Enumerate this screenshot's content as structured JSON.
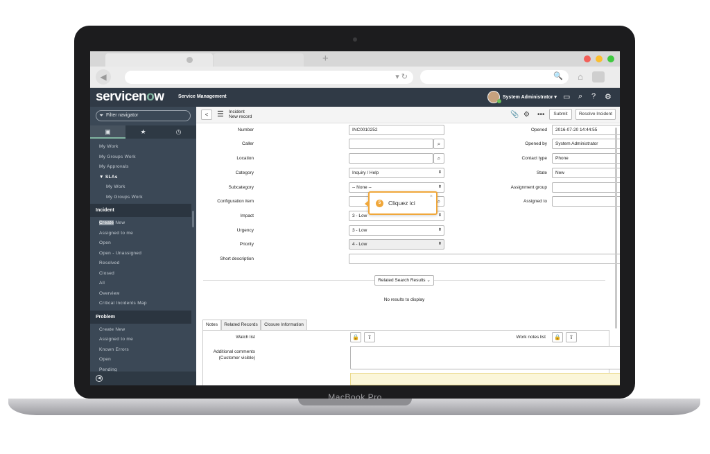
{
  "device": {
    "label": "MacBook Pro"
  },
  "browser": {
    "new_tab_symbol": "+"
  },
  "header": {
    "logo_prefix": "service",
    "logo_o": "o",
    "logo_suffix": "w",
    "logo_n": "n",
    "product": "Service Management",
    "user_name": "System Administrator ▾"
  },
  "sidebar": {
    "filter_placeholder": "Filter navigator",
    "items_top": [
      {
        "label": "My Work"
      },
      {
        "label": "My Groups Work"
      },
      {
        "label": "My Approvals"
      },
      {
        "label": "▼  SLAs"
      },
      {
        "label": "My Work"
      },
      {
        "label": "My Groups Work"
      }
    ],
    "section_incident": "Incident",
    "incident_items": [
      {
        "label_hl": "Create",
        "label": " New"
      },
      {
        "label": "Assigned to me"
      },
      {
        "label": "Open"
      },
      {
        "label": "Open - Unassigned"
      },
      {
        "label": "Resolved"
      },
      {
        "label": "Closed"
      },
      {
        "label": "All"
      },
      {
        "label": "Overview"
      },
      {
        "label": "Critical Incidents Map"
      }
    ],
    "section_problem": "Problem",
    "problem_items": [
      {
        "label": "Create New"
      },
      {
        "label": "Assigned to me"
      },
      {
        "label": "Known Errors"
      },
      {
        "label": "Open"
      },
      {
        "label": "Pending"
      }
    ]
  },
  "form": {
    "record_type": "Incident",
    "record_state": "New record",
    "submit_label": "Submit",
    "resolve_label": "Resolve Incident",
    "fields": {
      "number": {
        "label": "Number",
        "value": "INC0010252"
      },
      "caller": {
        "label": "Caller",
        "value": ""
      },
      "location": {
        "label": "Location",
        "value": ""
      },
      "category": {
        "label": "Category",
        "value": "Inquiry / Help"
      },
      "subcategory": {
        "label": "Subcategory",
        "value": "-- None --"
      },
      "config_item": {
        "label": "Configuration item",
        "value": ""
      },
      "impact": {
        "label": "Impact",
        "value": "3 - Low"
      },
      "urgency": {
        "label": "Urgency",
        "value": "3 - Low"
      },
      "priority": {
        "label": "Priority",
        "value": "4 - Low"
      },
      "short_description": {
        "label": "Short description",
        "value": ""
      },
      "opened": {
        "label": "Opened",
        "value": "2016-07-20 14:44:55"
      },
      "opened_by": {
        "label": "Opened by",
        "value": "System Administrator"
      },
      "contact_type": {
        "label": "Contact type",
        "value": "Phone"
      },
      "state": {
        "label": "State",
        "value": "New"
      },
      "assignment_group": {
        "label": "Assignment group",
        "value": ""
      },
      "assigned_to": {
        "label": "Assigned to",
        "value": ""
      }
    },
    "related_search": "Related Search Results",
    "no_results": "No results to display",
    "tabs": [
      {
        "label": "Notes"
      },
      {
        "label": "Related Records"
      },
      {
        "label": "Closure Information"
      }
    ],
    "watch_list": "Watch list",
    "work_notes_list": "Work notes list",
    "additional_comments_1": "Additional comments",
    "additional_comments_2": "(Customer visible)"
  },
  "tooltip": {
    "step": "5",
    "text": "Cliquez ici",
    "close": "×"
  },
  "colors": {
    "header_bg": "#303a46",
    "sidebar_bg": "#3b4856",
    "accent_green": "#81b5a1",
    "tooltip_orange": "#f0a73a"
  }
}
